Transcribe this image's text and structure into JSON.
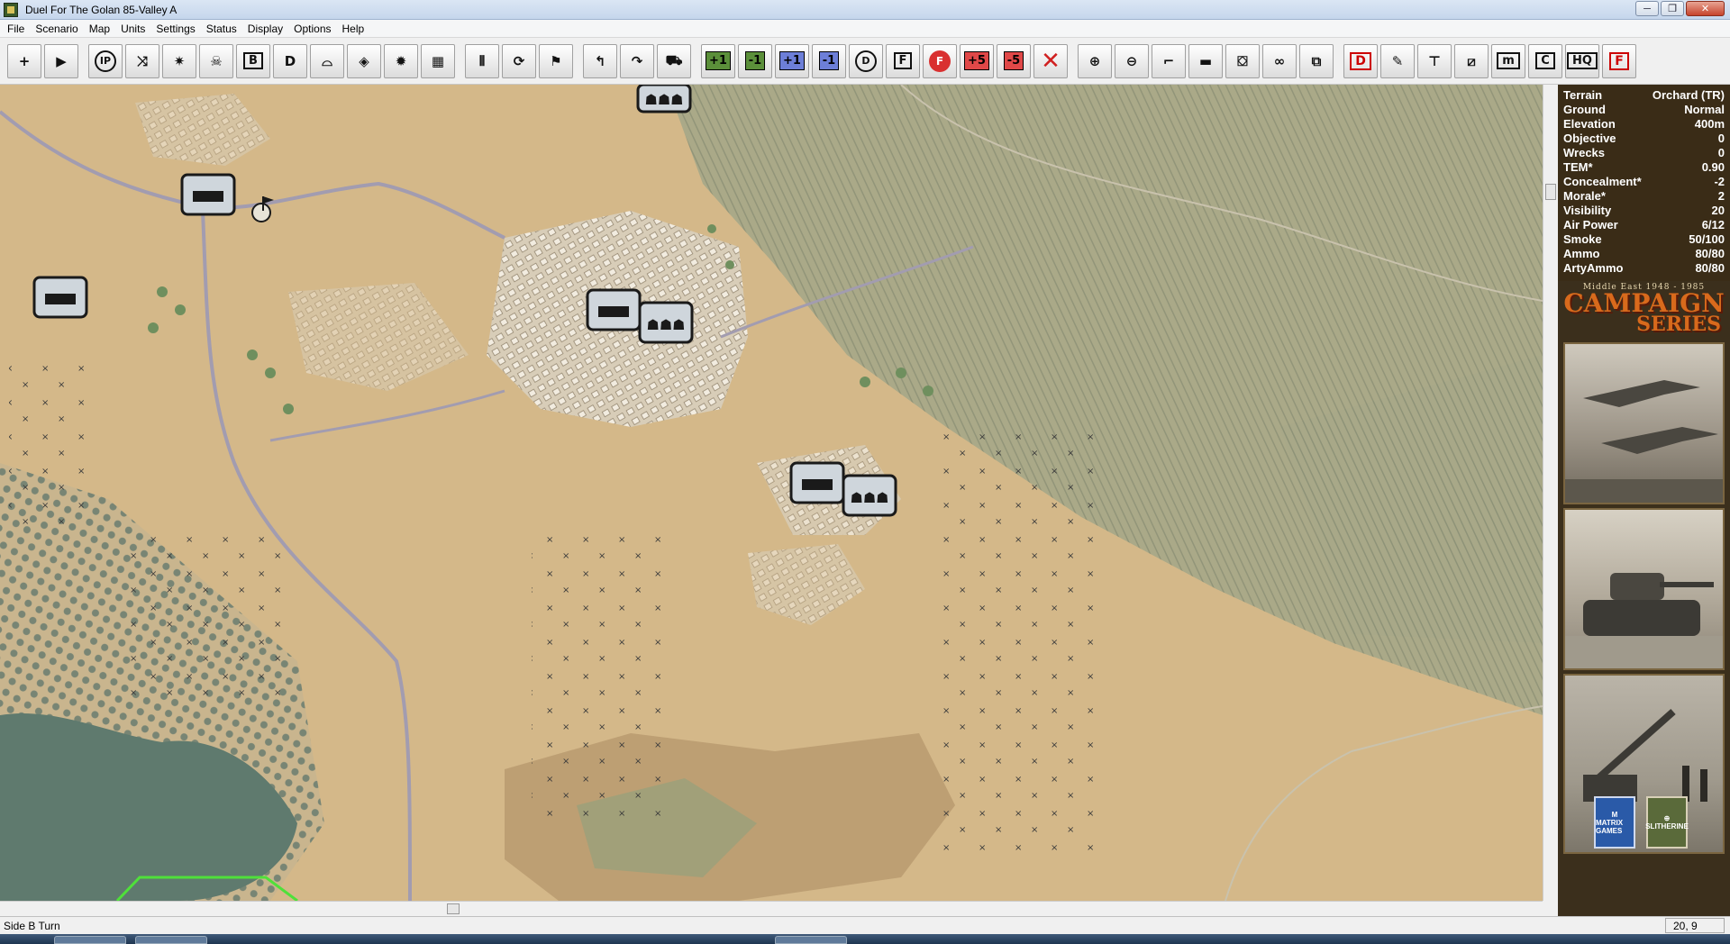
{
  "window": {
    "title": "Duel For The Golan 85-Valley A",
    "controls": {
      "minimize": "─",
      "restore": "❐",
      "close": "✕"
    }
  },
  "menu": [
    "File",
    "Scenario",
    "Map",
    "Units",
    "Settings",
    "Status",
    "Display",
    "Options",
    "Help"
  ],
  "toolbar": {
    "buttons": [
      {
        "name": "crosshair-tool",
        "icon": "+"
      },
      {
        "name": "play-button",
        "icon": "▶"
      },
      {
        "name": "ip-button",
        "icon": "IP"
      },
      {
        "name": "move-paths-button",
        "icon": "⤨"
      },
      {
        "name": "fire-paths-button",
        "icon": "✷"
      },
      {
        "name": "skull-button",
        "icon": "☠"
      },
      {
        "name": "b-button",
        "icon": "B"
      },
      {
        "name": "d-hex-button",
        "icon": "D"
      },
      {
        "name": "arc-button",
        "icon": "⌓"
      },
      {
        "name": "hex-target-button",
        "icon": "◈"
      },
      {
        "name": "explosion-button",
        "icon": "✹"
      },
      {
        "name": "mine-button",
        "icon": "▦"
      },
      {
        "name": "bridge-button",
        "icon": "⫴"
      },
      {
        "name": "rotate-button",
        "icon": "⟳"
      },
      {
        "name": "flag-button",
        "icon": "⚑"
      },
      {
        "name": "turn-left-button",
        "icon": "↰"
      },
      {
        "name": "turn-right-button",
        "icon": "↷"
      },
      {
        "name": "vehicle-button",
        "icon": "⛟"
      },
      {
        "name": "green-plus-one-button",
        "icon": "+1"
      },
      {
        "name": "green-minus-one-button",
        "icon": "-1"
      },
      {
        "name": "blue-plus-one-button",
        "icon": "+1"
      },
      {
        "name": "blue-minus-one-button",
        "icon": "-1"
      },
      {
        "name": "d-circle-button",
        "icon": "D"
      },
      {
        "name": "f-box-button",
        "icon": "F"
      },
      {
        "name": "f-red-circle-button",
        "icon": "F"
      },
      {
        "name": "red-plus-five-button",
        "icon": "+5"
      },
      {
        "name": "red-minus-five-button",
        "icon": "-5"
      },
      {
        "name": "cancel-button",
        "icon": "✕"
      },
      {
        "name": "zoom-in-button",
        "icon": "⊕"
      },
      {
        "name": "zoom-out-button",
        "icon": "⊖"
      },
      {
        "name": "terrain-button",
        "icon": "⌐"
      },
      {
        "name": "unit-button",
        "icon": "▬"
      },
      {
        "name": "map-button",
        "icon": "⛋"
      },
      {
        "name": "binoculars-button",
        "icon": "∞"
      },
      {
        "name": "overview-button",
        "icon": "⧉"
      },
      {
        "name": "d-red-box-button",
        "icon": "D"
      },
      {
        "name": "pencil-button",
        "icon": "✎"
      },
      {
        "name": "org-chart-button",
        "icon": "⊤"
      },
      {
        "name": "slash-button",
        "icon": "⧄"
      },
      {
        "name": "m-button",
        "icon": "m"
      },
      {
        "name": "c-button",
        "icon": "C"
      },
      {
        "name": "hq-button",
        "icon": "HQ"
      },
      {
        "name": "f-red-box-button",
        "icon": "F"
      }
    ]
  },
  "info_panel": {
    "rows": [
      {
        "label": "Terrain",
        "value": "Orchard (TR)"
      },
      {
        "label": "Ground",
        "value": "Normal"
      },
      {
        "label": "Elevation",
        "value": "400m"
      },
      {
        "label": "Objective",
        "value": "0"
      },
      {
        "label": "Wrecks",
        "value": "0"
      },
      {
        "label": "TEM*",
        "value": "0.90"
      },
      {
        "label": "Concealment*",
        "value": "-2"
      },
      {
        "label": "Morale*",
        "value": "2"
      },
      {
        "label": "Visibility",
        "value": "20"
      },
      {
        "label": "Air Power",
        "value": "6/12"
      },
      {
        "label": "Smoke",
        "value": "50/100"
      },
      {
        "label": "Ammo",
        "value": "80/80"
      },
      {
        "label": "ArtyAmmo",
        "value": "80/80"
      }
    ]
  },
  "logo": {
    "subtitle": "Middle East 1948 - 1985",
    "line1": "CAMPAIGN",
    "line2": "SERIES"
  },
  "badges": {
    "matrix": "MATRIX GAMES",
    "slith": "SLITHERINE"
  },
  "status": {
    "left": "Side B Turn",
    "right": "20, 9"
  },
  "colors": {
    "map_base": "#d4b889",
    "panel_bg": "#3a2c17",
    "logo_orange": "#d86a1c"
  }
}
